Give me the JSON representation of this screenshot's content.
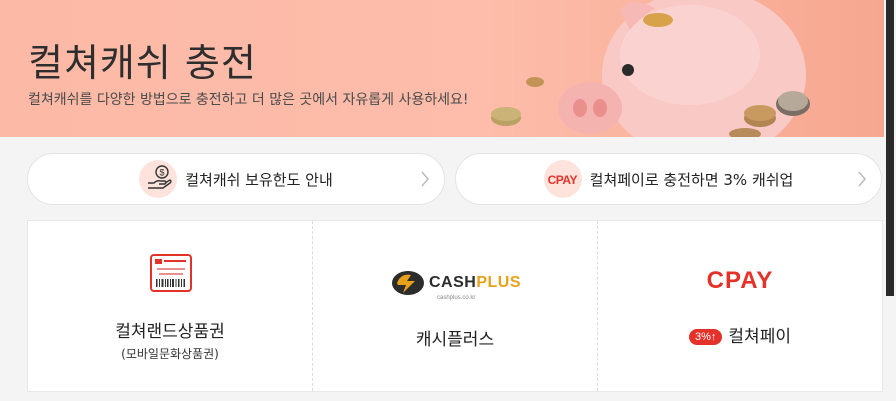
{
  "banner": {
    "title": "컬쳐캐쉬 충전",
    "subtitle": "컬쳐캐쉬를 다양한 방법으로 충전하고 더 많은 곳에서 자유롭게 사용하세요!"
  },
  "info_links": [
    {
      "label": "컬쳐캐쉬 보유한도 안내",
      "icon": "coin-hand-icon"
    },
    {
      "label": "컬쳐페이로 충전하면 3% 캐쉬업",
      "logo_text": "CPAY"
    }
  ],
  "charge_options": [
    {
      "label": "컬쳐랜드상품권",
      "sub": "(모바일문화상품권)",
      "icon": "gift-card-icon"
    },
    {
      "label": "캐시플러스",
      "logo_main": "CASH",
      "logo_plus": "PLUS",
      "logo_url": "cashplus.co.kr"
    },
    {
      "label": "컬쳐페이",
      "logo_text": "CPAY",
      "badge": "3%↑"
    }
  ],
  "colors": {
    "accent": "#e4322b",
    "banner_bg": "#fcb9a6",
    "cashplus_gold": "#e8a21a"
  }
}
